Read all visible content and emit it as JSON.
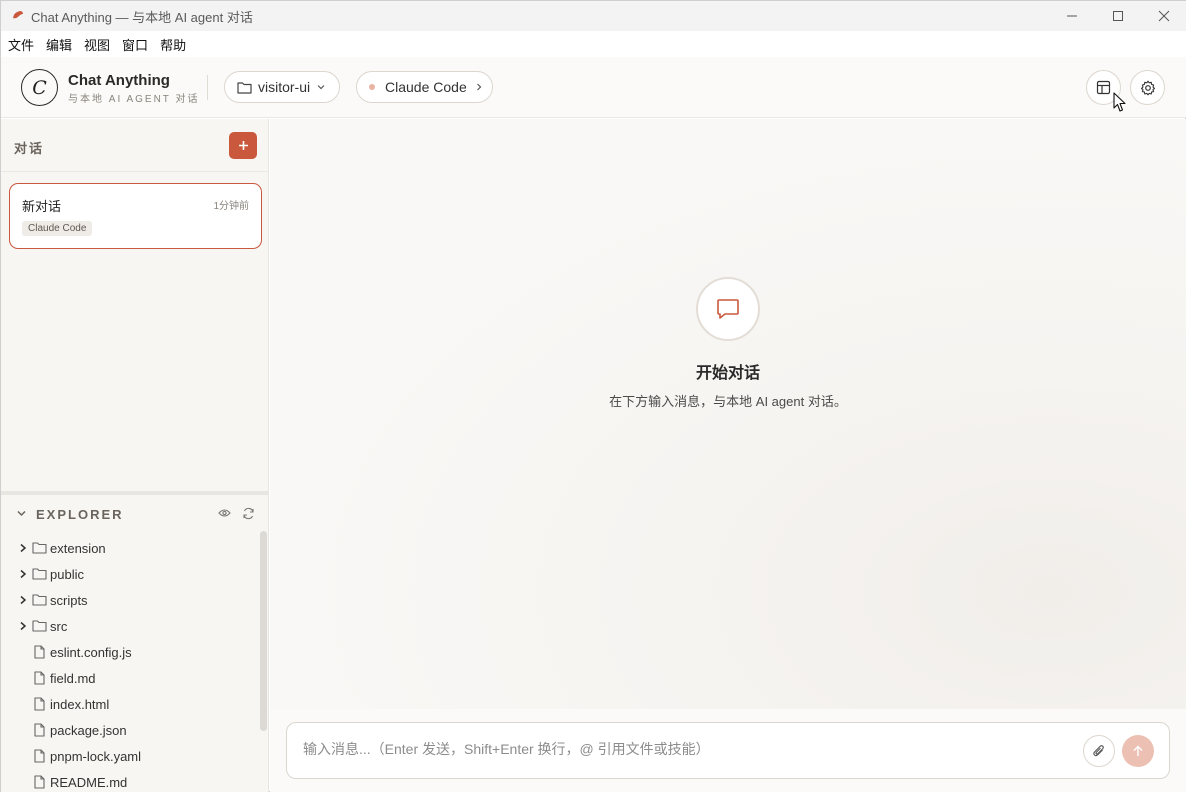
{
  "window": {
    "title": "Chat Anything — 与本地 AI agent 对话",
    "app_icon": "app-logo-icon",
    "controls": [
      "minimize-icon",
      "maximize-icon",
      "close-icon"
    ]
  },
  "menu": [
    "文件",
    "编辑",
    "视图",
    "窗口",
    "帮助"
  ],
  "header": {
    "brand_letter": "C",
    "brand_name": "Chat Anything",
    "brand_sub": "与本地 AI AGENT 对话",
    "project": "visitor-ui",
    "agent": "Claude Code",
    "accent": "#c9583c"
  },
  "sidebar": {
    "heading": "对话",
    "conversations": [
      {
        "title": "新对话",
        "time": "1分钟前",
        "tag": "Claude Code"
      }
    ]
  },
  "explorer": {
    "title": "EXPLORER",
    "items": [
      {
        "name": "extension",
        "type": "folder"
      },
      {
        "name": "public",
        "type": "folder"
      },
      {
        "name": "scripts",
        "type": "folder"
      },
      {
        "name": "src",
        "type": "folder"
      },
      {
        "name": "eslint.config.js",
        "type": "file"
      },
      {
        "name": "field.md",
        "type": "file"
      },
      {
        "name": "index.html",
        "type": "file"
      },
      {
        "name": "package.json",
        "type": "file"
      },
      {
        "name": "pnpm-lock.yaml",
        "type": "file"
      },
      {
        "name": "README.md",
        "type": "file"
      }
    ]
  },
  "main": {
    "empty_title": "开始对话",
    "empty_sub": "在下方输入消息，与本地 AI agent 对话。"
  },
  "composer": {
    "placeholder": "输入消息...（Enter 发送，Shift+Enter 换行，@ 引用文件或技能）"
  }
}
